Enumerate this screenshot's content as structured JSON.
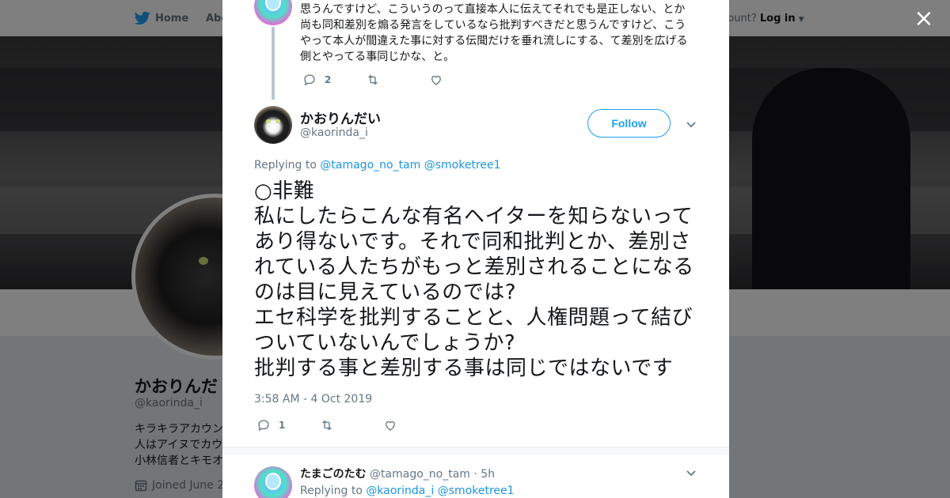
{
  "nav": {
    "home_label": "Home",
    "about_label": "Abo",
    "account_prompt": "ccount?",
    "login_label": "Log in"
  },
  "profile": {
    "name": "かおりんだ",
    "handle": "@kaorinda_i",
    "bio_lines": [
      "キラキラアカウン",
      "人はアイヌでカウ",
      "小林信者とキモオ"
    ],
    "joined": "Joined June 2"
  },
  "close_label": "×",
  "parent_tweet": {
    "text": "思うんですけど、こういうのって直接本人に伝えてそれでも是正しない、とか尚も同和差別を煽る発言をしているなら批判すべきだと思うんですけど、こうやって本人が間違えた事に対する伝聞だけを垂れ流しにする、て差別を広げる側とやってる事同じかな、と。",
    "reply_count": "2",
    "retweet_count": "",
    "like_count": ""
  },
  "main_tweet": {
    "author_name": "かおりんだい",
    "author_handle": "@kaorinda_i",
    "follow_label": "Follow",
    "replying_prefix": "Replying to",
    "replying_to": [
      "@tamago_no_tam",
      "@smoketree1"
    ],
    "text": "○非難\n私にしたらこんな有名ヘイターを知らないってあり得ないです。それで同和批判とか、差別されている人たちがもっと差別されることになるのは目に見えているのでは?\nエセ科学を批判することと、人権問題って結びついていないんでしょうか?\n批判する事と差別する事は同じではないです",
    "timestamp": "3:58 AM - 4 Oct 2019",
    "reply_count": "1",
    "retweet_count": "",
    "like_count": ""
  },
  "reply_tweet": {
    "author_name": "たまごのたむ",
    "author_handle": "@tamago_no_tam",
    "separator": "·",
    "time": "5h",
    "replying_prefix": "Replying to",
    "replying_to": [
      "@kaorinda_i",
      "@smoketree1"
    ]
  },
  "colors": {
    "twitter_blue": "#1da1f2",
    "link_blue": "#1b95e0",
    "muted_gray": "#657786",
    "text_dark": "#14171a"
  },
  "icons": {
    "brand": "twitter-bird-icon",
    "reply": "reply-icon",
    "retweet": "retweet-icon",
    "like": "heart-icon",
    "more": "chevron-down-icon",
    "close": "close-icon",
    "calendar": "calendar-icon"
  }
}
